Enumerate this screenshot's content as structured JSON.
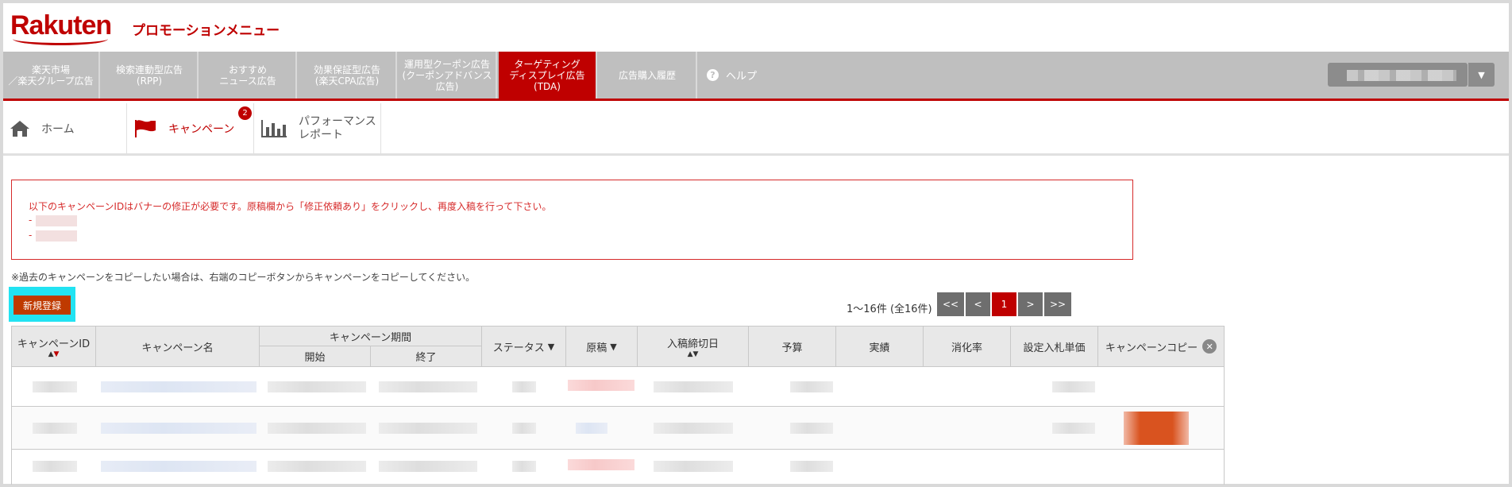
{
  "brand": {
    "logo": "Rakuten",
    "app_title": "プロモーションメニュー",
    "accent": "#bf0000"
  },
  "top_nav": {
    "items": [
      {
        "label": "楽天市場\n／楽天グループ広告"
      },
      {
        "label": "検索連動型広告\n(RPP)"
      },
      {
        "label": "おすすめ\nニュース広告"
      },
      {
        "label": "効果保証型広告\n(楽天CPA広告)"
      },
      {
        "label": "運用型クーポン広告\n(クーポンアドバンス\n広告)"
      },
      {
        "label": "ターゲティング\nディスプレイ広告\n(TDA)"
      },
      {
        "label": "広告購入履歴"
      }
    ],
    "help": "ヘルプ",
    "help_icon": "?",
    "account_caret": "▼"
  },
  "sub_nav": {
    "items": [
      {
        "label": "ホーム",
        "icon": "home-icon"
      },
      {
        "label": "キャンペーン",
        "icon": "flag-icon",
        "badge": "2"
      },
      {
        "label": "パフォーマンス\nレポート",
        "icon": "bar-chart-icon"
      }
    ]
  },
  "alert": {
    "message": "以下のキャンペーンIDはバナーの修正が必要です。原稿欄から「修正依頼あり」をクリックし、再度入稿を行って下さい。",
    "bullet": "-"
  },
  "note": "※過去のキャンペーンをコピーしたい場合は、右端のコピーボタンからキャンペーンをコピーしてください。",
  "new_button": "新規登録",
  "pagination": {
    "count_text": "1〜16件 (全16件)",
    "first": "<<",
    "prev": "<",
    "current": "1",
    "next": ">",
    "last": ">>"
  },
  "table": {
    "headers": {
      "campaign_id": "キャンペーンID",
      "campaign_name": "キャンペーン名",
      "period": "キャンペーン期間",
      "start": "開始",
      "end": "終了",
      "status": "ステータス",
      "draft": "原稿",
      "deadline": "入稿締切日",
      "budget": "予算",
      "actual": "実績",
      "consumption": "消化率",
      "bid": "設定入札単価",
      "copy": "キャンペーンコピー"
    },
    "sort_up": "▲",
    "sort_down": "▼",
    "filter_icon": "▼",
    "close_icon": "✕"
  }
}
